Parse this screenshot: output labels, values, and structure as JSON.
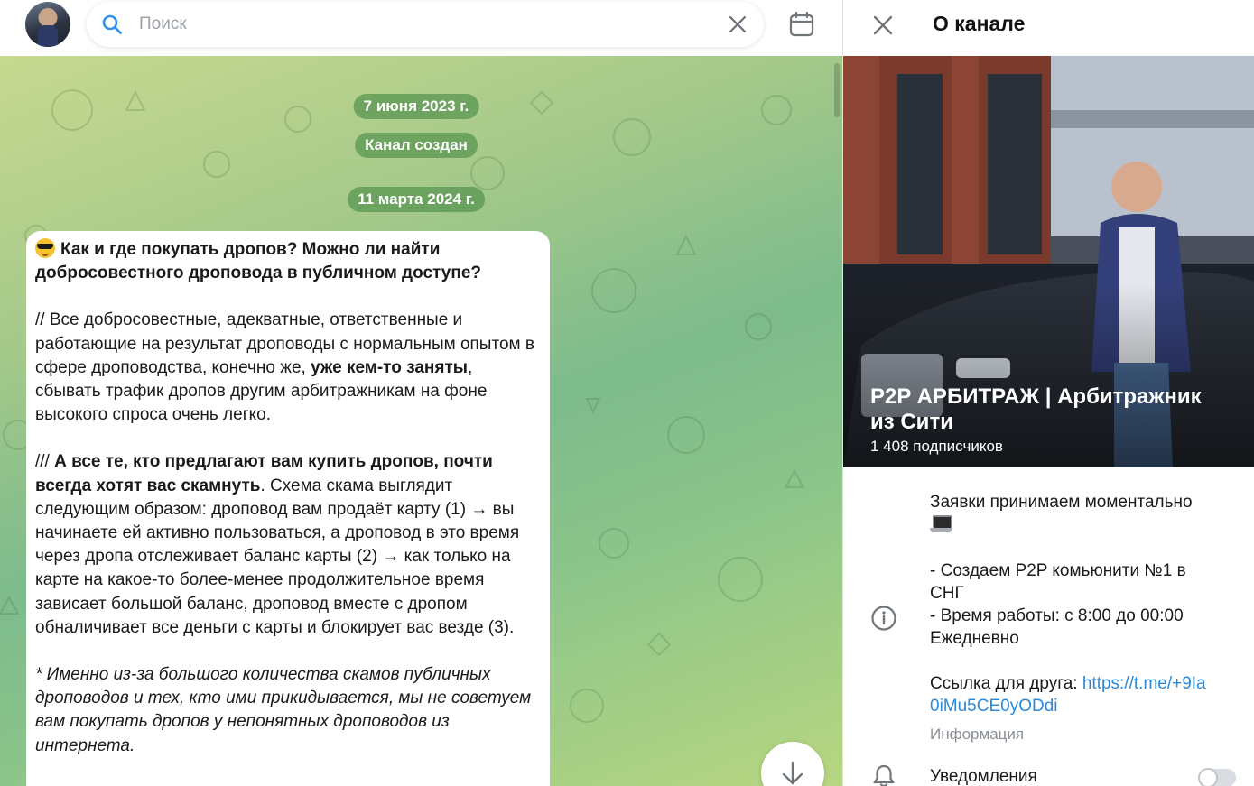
{
  "search": {
    "placeholder": "Поиск"
  },
  "chat": {
    "date_1": "7 июня 2023 г.",
    "service": "Канал создан",
    "date_2": "11 марта 2024 г.",
    "message": {
      "title": "Как и где покупать дропов? Можно ли найти добросовестного дроповода в публичном доступе?",
      "p1_start": "// Все добросовестные, адекватные, ответственные и работающие на результат дроповоды с нормальным опытом в сфере дроповодства, конечно же, ",
      "p1_bold": "уже кем-то заняты",
      "p1_end": ", сбывать трафик дропов другим арбитражникам на фоне высокого спроса очень легко.",
      "p2_start": "/// ",
      "p2_bold": "А все те, кто предлагают вам купить дропов, почти всегда хотят вас скамнуть",
      "p2_end": ". Схема скама выглядит следующим образом: дроповод вам продаёт карту (1) → вы начинаете ей активно пользоваться, а дроповод в это время через дропа отслеживает баланс карты (2) → как только на карте на какое-то более-менее продолжительное время зависает большой баланс, дроповод вместе с дропом обналичивает все деньги с карты и блокирует вас везде (3).",
      "p3": "* Именно из-за большого количества скамов публичных дроповодов и тех, кто ими прикидывается, мы не советуем вам покупать дропов у непонятных дроповодов из интернета."
    }
  },
  "panel": {
    "title": "О канале",
    "channel_name": "P2P АРБИТРАЖ | Арбитражник из Сити",
    "subscribers": "1 408 подписчиков",
    "description": {
      "line_1": "Заявки принимаем моментально",
      "line_2": "- Создаем P2P комьюнити №1 в",
      "line_3": "СНГ",
      "line_4": "- Время работы: с 8:00 до 00:00",
      "line_5": "Ежедневно",
      "link_label": "Ссылка для друга: ",
      "link_1": "https://t.me/+9Ia",
      "link_2": "0iMu5CE0yODdi",
      "caption": "Информация"
    },
    "notifications_label": "Уведомления",
    "notifications_on": false
  },
  "icons": [
    "search-icon",
    "clear-icon",
    "calendar-icon",
    "arrow-down-icon",
    "close-icon",
    "info-icon",
    "bell-icon"
  ],
  "colors": {
    "accent": "#2c89d6",
    "date_pill": "#5a9650"
  }
}
